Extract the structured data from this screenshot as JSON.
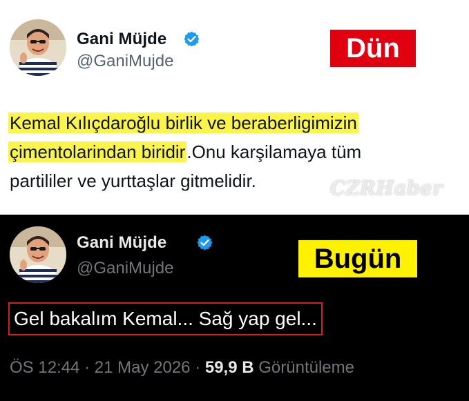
{
  "colors": {
    "top_bg": "#ffffff",
    "bottom_bg": "#000000",
    "verified_blue": "#1d9bf0",
    "badge_red": "#e00010",
    "badge_yellow": "#fff200",
    "highlight": "#fbf44a",
    "box_red": "#d11f1f"
  },
  "top_tweet": {
    "avatar_icon": "avatar-photo",
    "name": "Gani Müjde",
    "handle": "@GaniMujde",
    "badge": "Dün",
    "line1_highlight": "Kemal Kılıçdaroğlu birlik ve beraberligimizin",
    "line2_highlight": "çimentolarindan biridir",
    "line2_rest": ".Onu karşilamaya tüm",
    "line3": "partililer ve yurttaşlar gitmelidir.",
    "watermark": "CZRHaber"
  },
  "bottom_tweet": {
    "avatar_icon": "avatar-photo",
    "name": "Gani Müjde",
    "handle": "@GaniMujde",
    "badge": "Bugün",
    "text": "Gel bakalım Kemal... Sağ yap gel...",
    "time": "ÖS 12:44",
    "sep1": "·",
    "date": "21 May 2026",
    "sep2": "·",
    "views": "59,9 B",
    "views_label": "Görüntüleme"
  }
}
